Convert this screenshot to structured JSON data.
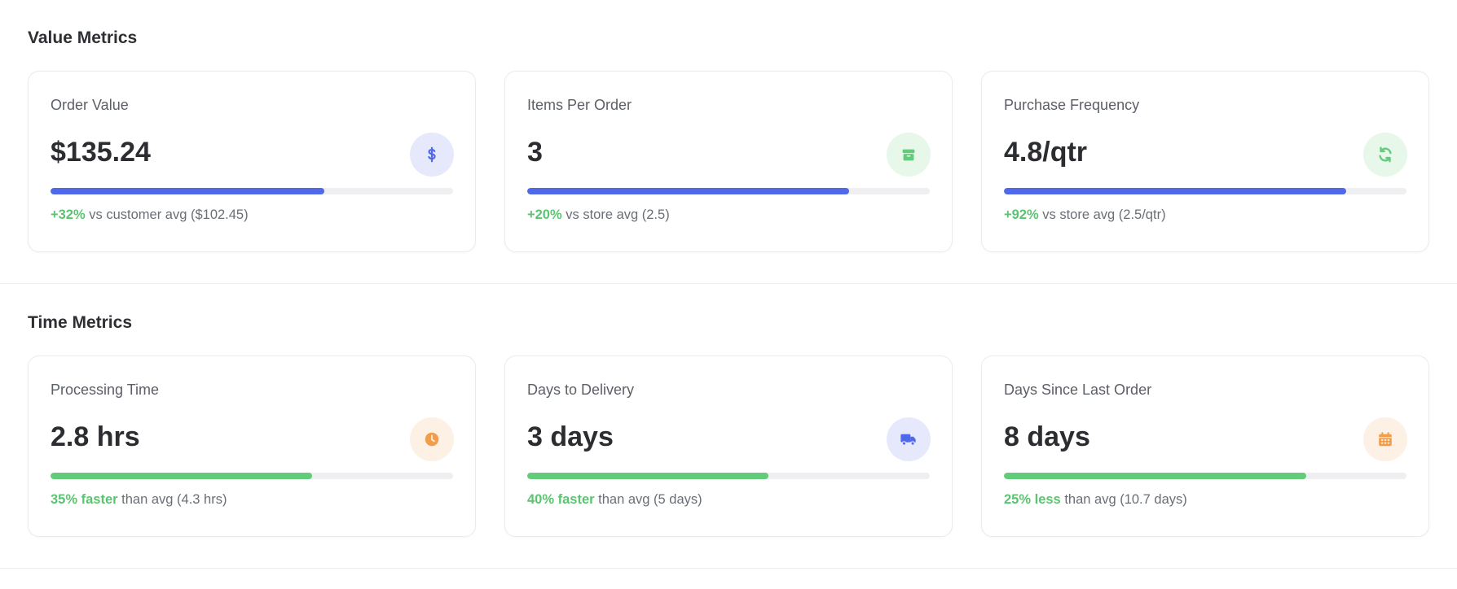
{
  "colors": {
    "blue": "#5068ea",
    "green": "#63cc7a",
    "orange": "#f29d4b",
    "blue_bg": "#e6e9fb",
    "green_bg": "#e7f7ea",
    "orange_bg": "#fdf0e4"
  },
  "sections": [
    {
      "title": "Value Metrics",
      "cards": [
        {
          "label": "Order Value",
          "value": "$135.24",
          "icon": "dollar-icon",
          "progress_pct": 68,
          "bar_color": "blue",
          "highlight": "+32%",
          "note": " vs customer avg ($102.45)"
        },
        {
          "label": "Items Per Order",
          "value": "3",
          "icon": "box-icon",
          "progress_pct": 80,
          "bar_color": "blue",
          "highlight": "+20%",
          "note": " vs store avg (2.5)"
        },
        {
          "label": "Purchase Frequency",
          "value": "4.8/qtr",
          "icon": "refresh-icon",
          "progress_pct": 85,
          "bar_color": "blue",
          "highlight": "+92%",
          "note": " vs store avg (2.5/qtr)"
        }
      ]
    },
    {
      "title": "Time Metrics",
      "cards": [
        {
          "label": "Processing Time",
          "value": "2.8 hrs",
          "icon": "clock-icon",
          "progress_pct": 65,
          "bar_color": "green",
          "highlight": "35% faster",
          "note": " than avg (4.3 hrs)"
        },
        {
          "label": "Days to Delivery",
          "value": "3 days",
          "icon": "truck-icon",
          "progress_pct": 60,
          "bar_color": "green",
          "highlight": "40% faster",
          "note": " than avg (5 days)"
        },
        {
          "label": "Days Since Last Order",
          "value": "8 days",
          "icon": "calendar-icon",
          "progress_pct": 75,
          "bar_color": "green",
          "highlight": "25% less",
          "note": " than avg (10.7 days)"
        }
      ]
    }
  ]
}
